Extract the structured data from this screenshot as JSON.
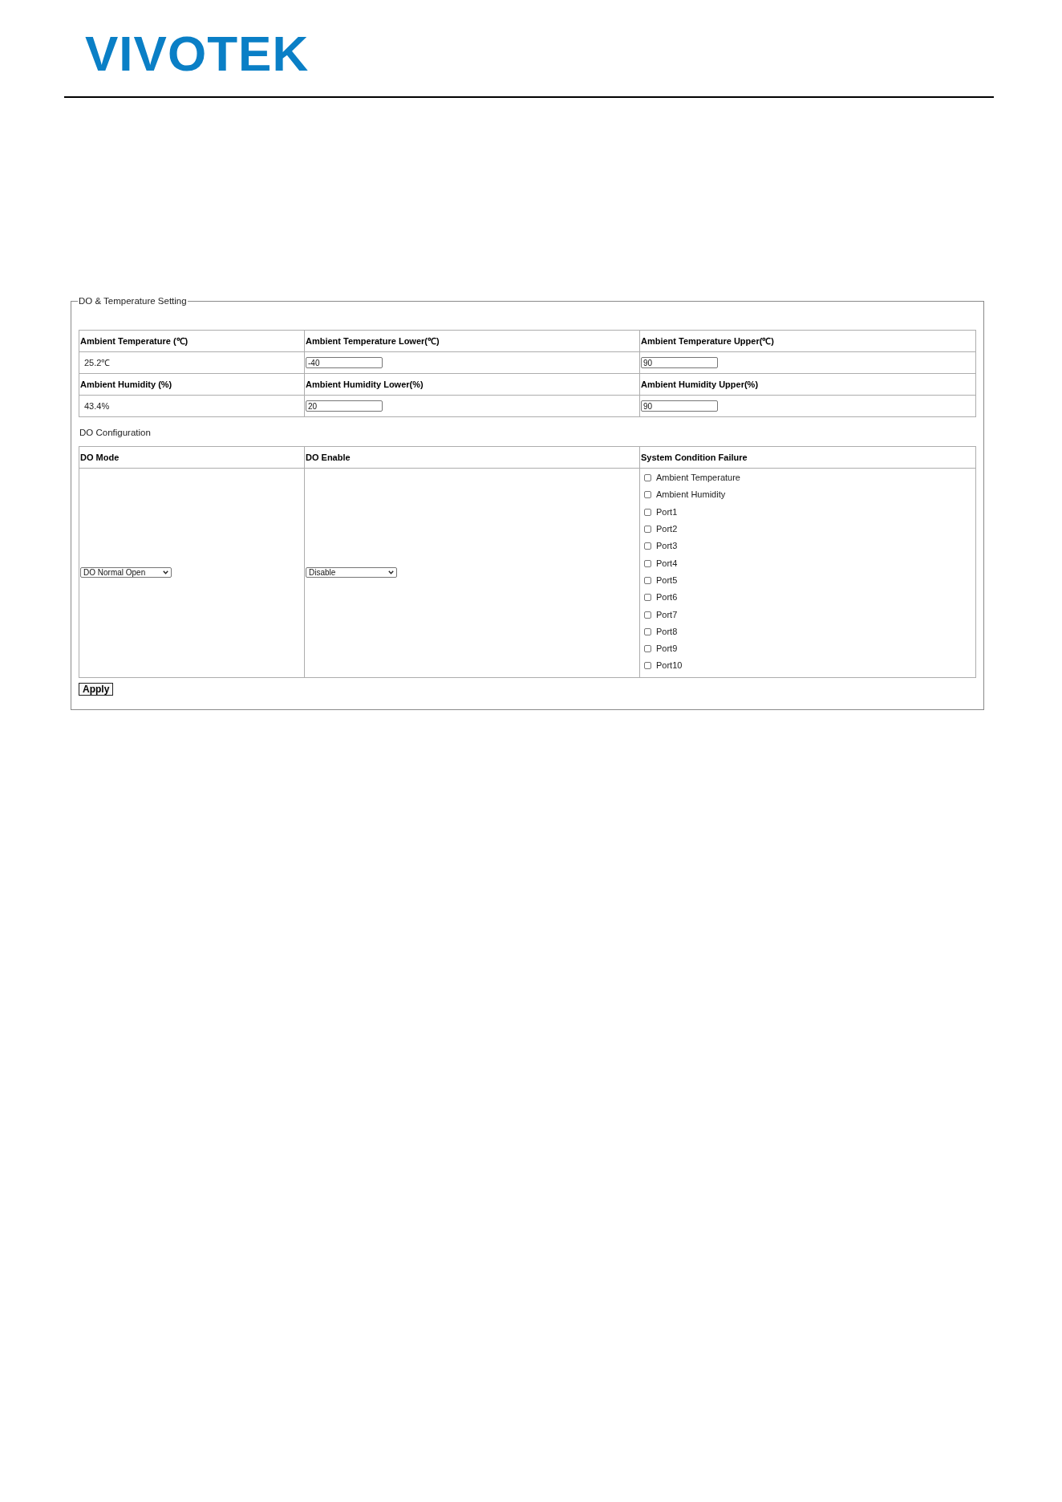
{
  "logo": {
    "text": "VIVOTEK"
  },
  "settings": {
    "legend": "DO & Temperature Setting",
    "sensor_table": {
      "groups": [
        {
          "headers": [
            "Ambient Temperature (℃)",
            "Ambient Temperature Lower(℃)",
            "Ambient Temperature Upper(℃)"
          ],
          "reading": "25.2℃",
          "lower": "-40",
          "upper": "90"
        },
        {
          "headers": [
            "Ambient Humidity (%)",
            "Ambient Humidity Lower(%)",
            "Ambient Humidity Upper(%)"
          ],
          "reading": "43.4%",
          "lower": "20",
          "upper": "90"
        }
      ]
    },
    "do_configuration": {
      "title": "DO Configuration",
      "columns": [
        "DO Mode",
        "DO Enable",
        "System Condition Failure"
      ],
      "do_mode": {
        "value": "DO Normal Open"
      },
      "do_enable": {
        "value": "Disable"
      },
      "conditions": [
        {
          "label": "Ambient Temperature",
          "checked": false
        },
        {
          "label": "Ambient Humidity",
          "checked": false
        },
        {
          "label": "Port1",
          "checked": false
        },
        {
          "label": "Port2",
          "checked": false
        },
        {
          "label": "Port3",
          "checked": false
        },
        {
          "label": "Port4",
          "checked": false
        },
        {
          "label": "Port5",
          "checked": false
        },
        {
          "label": "Port6",
          "checked": false
        },
        {
          "label": "Port7",
          "checked": false
        },
        {
          "label": "Port8",
          "checked": false
        },
        {
          "label": "Port9",
          "checked": false
        },
        {
          "label": "Port10",
          "checked": false
        }
      ]
    },
    "apply_button": "Apply"
  }
}
